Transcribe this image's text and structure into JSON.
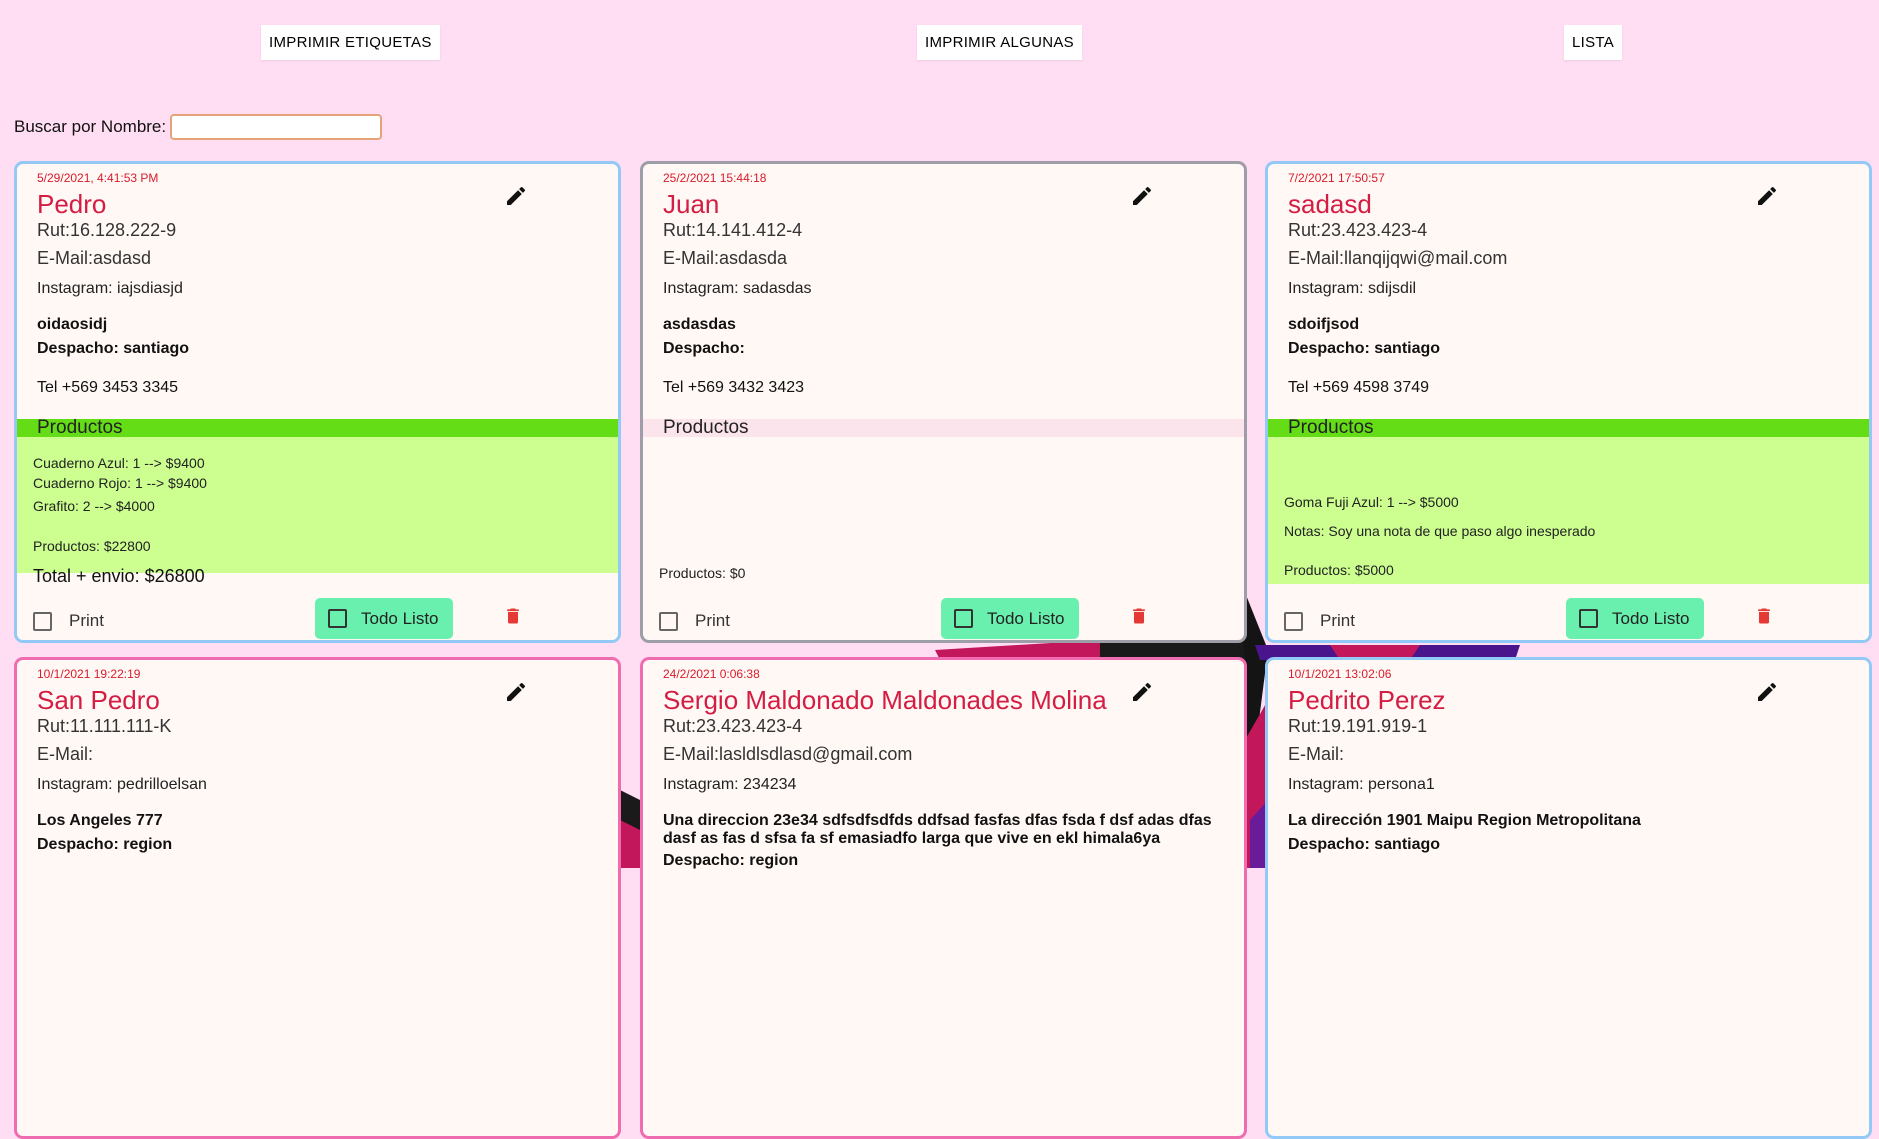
{
  "header": {
    "btn_etiquetas": "IMPRIMIR ETIQUETAS",
    "btn_algunas": "IMPRIMIR ALGUNAS",
    "btn_lista": "LISTA"
  },
  "search": {
    "label": "Buscar por Nombre:",
    "value": "",
    "placeholder": ""
  },
  "labels": {
    "productos": "Productos",
    "print": "Print",
    "todo_listo": "Todo Listo"
  },
  "colors": {
    "background": "#ffddf3",
    "card_bg": "#fff8f5",
    "name": "#d41d43",
    "date": "#d81b2b",
    "blue_border": "#92c9f7",
    "gray_border": "#9e9ea8",
    "pink_border": "#f06cb1",
    "products_header": "#64dd17",
    "products_bg": "#ccff90",
    "todo_button": "#69f0ae",
    "trash": "#e53935"
  },
  "icons": {
    "edit": "pencil-icon",
    "delete": "trash-icon",
    "checkbox": "checkbox-outline-icon"
  },
  "cards": [
    {
      "date": "5/29/2021, 4:41:53 PM",
      "name": "Pedro",
      "rut": "Rut:16.128.222-9",
      "email": "E-Mail:asdasd",
      "instagram": "Instagram: iajsdiasjd",
      "address": "oidaosidj",
      "despacho": "Despacho: santiago",
      "tel": "Tel +569 3453 3345",
      "products": [
        "Cuaderno Azul: 1 --> $9400",
        "Cuaderno Rojo: 1 --> $9400",
        "Grafito: 2 --> $4000"
      ],
      "subtotal": "Productos: $22800",
      "total": "Total + envio: $26800"
    },
    {
      "date": "25/2/2021 15:44:18",
      "name": "Juan",
      "rut": "Rut:14.141.412-4",
      "email": "E-Mail:asdasda",
      "instagram": "Instagram: sadasdas",
      "address": "asdasdas",
      "despacho": "Despacho:",
      "tel": "Tel +569 3432 3423",
      "products": [],
      "subtotal": "Productos: $0"
    },
    {
      "date": "7/2/2021 17:50:57",
      "name": "sadasd",
      "rut": "Rut:23.423.423-4",
      "email": "E-Mail:llanqijqwi@mail.com",
      "instagram": "Instagram: sdijsdil",
      "address": "sdoifjsod",
      "despacho": "Despacho: santiago",
      "tel": "Tel +569 4598 3749",
      "products": [
        "Goma Fuji Azul: 1 --> $5000"
      ],
      "notes": "Notas: Soy una nota de que paso algo inesperado",
      "subtotal": "Productos: $5000"
    },
    {
      "date": "10/1/2021 19:22:19",
      "name": "San Pedro",
      "rut": "Rut:11.111.111-K",
      "email": "E-Mail:",
      "instagram": "Instagram: pedrilloelsan",
      "address": "Los Angeles 777",
      "despacho": "Despacho: region"
    },
    {
      "date": "24/2/2021 0:06:38",
      "name": "Sergio Maldonado Maldonades Molina",
      "rut": "Rut:23.423.423-4",
      "email": "E-Mail:lasldlsdlasd@gmail.com",
      "instagram": "Instagram: 234234",
      "address": "Una direccion 23e34 sdfsdfsdfds ddfsad fasfas dfas fsda f dsf adas dfas dasf as fas d sfsa fa sf emasiadfo larga que vive en ekl himala6ya",
      "despacho": "Despacho: region"
    },
    {
      "date": "10/1/2021 13:02:06",
      "name": "Pedrito Perez",
      "rut": "Rut:19.191.919-1",
      "email": "E-Mail:",
      "instagram": "Instagram: persona1",
      "address": "La dirección 1901 Maipu Region Metropolitana",
      "despacho": "Despacho: santiago"
    }
  ]
}
